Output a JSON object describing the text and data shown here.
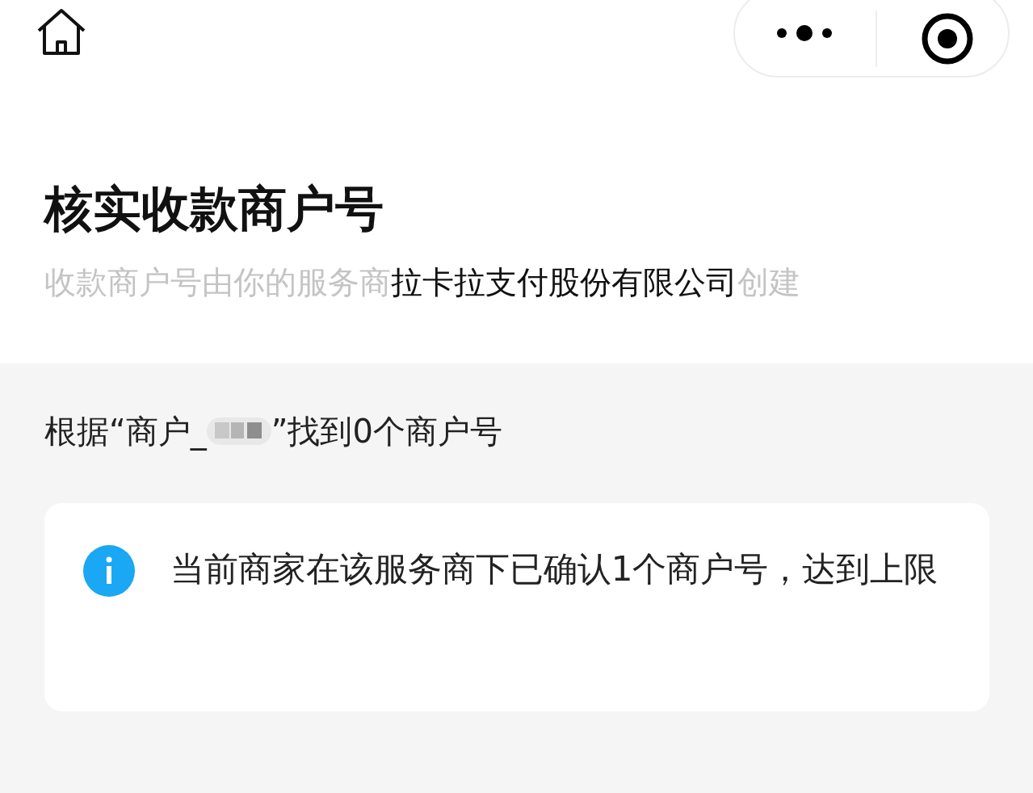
{
  "title": "核实收款商户号",
  "subtitle": [
    {
      "text": "收款商户号由你的服务商",
      "emphasis": false
    },
    {
      "text": "拉卡拉支付股份有限公司",
      "emphasis": true
    },
    {
      "text": "创建",
      "emphasis": false
    }
  ],
  "result": {
    "prefix": "根据“商户_",
    "suffix": "”找到0个商户号"
  },
  "notice": {
    "text": "当前商家在该服务商下已确认1个商户号，达到上限"
  }
}
